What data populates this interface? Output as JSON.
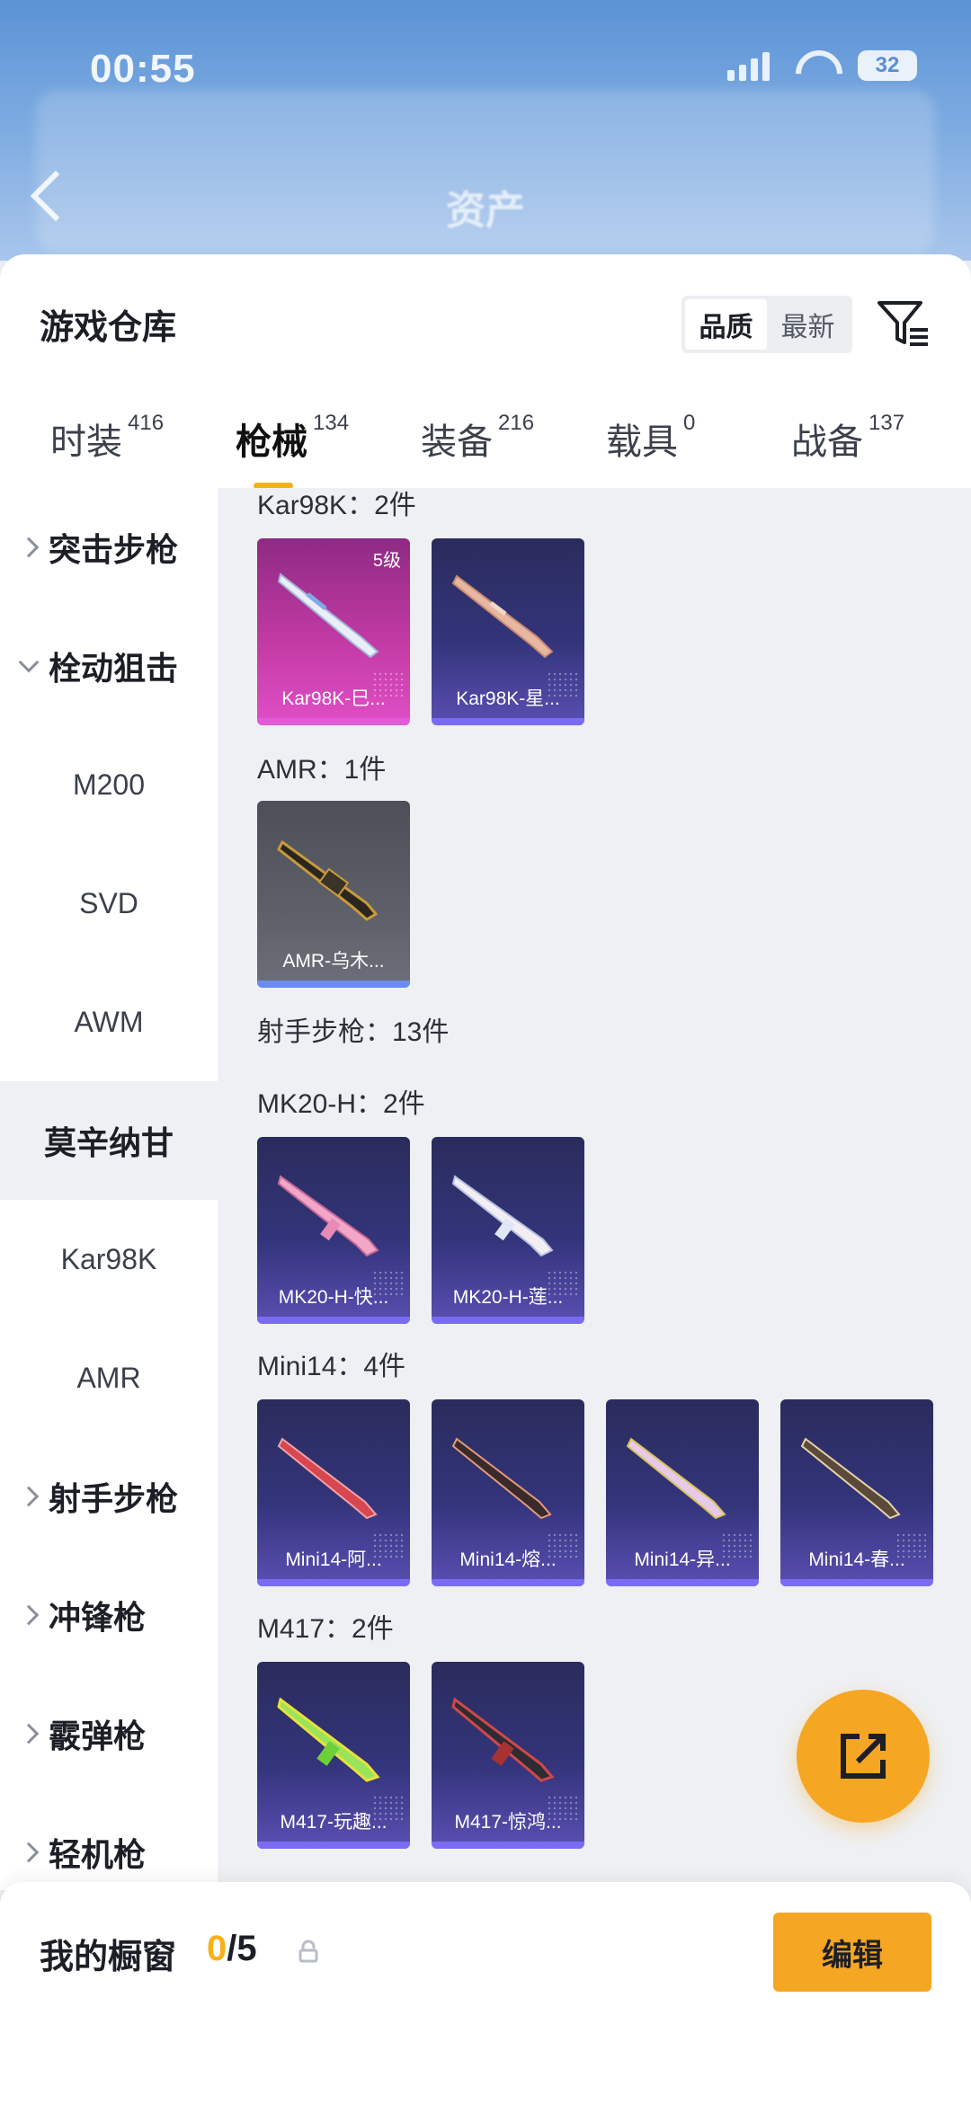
{
  "statusbar": {
    "time": "00:55",
    "battery": "32"
  },
  "nav": {
    "title": "资产"
  },
  "header": {
    "title": "游戏仓库",
    "sort": {
      "quality": "品质",
      "newest": "最新",
      "selected": "最新"
    }
  },
  "tabs": [
    {
      "label": "时装",
      "count": "416"
    },
    {
      "label": "枪械",
      "count": "134",
      "active": true
    },
    {
      "label": "装备",
      "count": "216"
    },
    {
      "label": "载具",
      "count": "0"
    },
    {
      "label": "战备",
      "count": "137"
    }
  ],
  "sidebar": [
    {
      "label": "突击步枪",
      "type": "category",
      "expanded": false
    },
    {
      "label": "栓动狙击",
      "type": "category",
      "expanded": true
    },
    {
      "label": "M200",
      "type": "sub"
    },
    {
      "label": "SVD",
      "type": "sub"
    },
    {
      "label": "AWM",
      "type": "sub"
    },
    {
      "label": "莫辛纳甘",
      "type": "sub",
      "selected": true
    },
    {
      "label": "Kar98K",
      "type": "sub"
    },
    {
      "label": "AMR",
      "type": "sub"
    },
    {
      "label": "射手步枪",
      "type": "category",
      "expanded": false
    },
    {
      "label": "冲锋枪",
      "type": "category",
      "expanded": false
    },
    {
      "label": "霰弹枪",
      "type": "category",
      "expanded": false
    },
    {
      "label": "轻机枪",
      "type": "category",
      "expanded": false
    }
  ],
  "groups": [
    {
      "title": "Kar98K：2件",
      "items": [
        {
          "name": "Kar98K-巳...",
          "level": "5级",
          "style": "gold"
        },
        {
          "name": "Kar98K-星...",
          "style": "purple"
        }
      ]
    },
    {
      "title": "AMR：1件",
      "items": [
        {
          "name": "AMR-乌木...",
          "style": "grey"
        }
      ]
    },
    {
      "title": "射手步枪：13件",
      "items": []
    },
    {
      "title": "MK20-H：2件",
      "items": [
        {
          "name": "MK20-H-快...",
          "style": "purple"
        },
        {
          "name": "MK20-H-莲...",
          "style": "purple"
        }
      ]
    },
    {
      "title": "Mini14：4件",
      "items": [
        {
          "name": "Mini14-阿...",
          "style": "purple"
        },
        {
          "name": "Mini14-熔...",
          "style": "purple"
        },
        {
          "name": "Mini14-异...",
          "style": "purple"
        },
        {
          "name": "Mini14-春...",
          "style": "purple"
        }
      ]
    },
    {
      "title": "M417：2件",
      "items": [
        {
          "name": "M417-玩趣...",
          "style": "purple"
        },
        {
          "name": "M417-惊鸿...",
          "style": "purple"
        }
      ]
    }
  ],
  "showcase": {
    "label": "我的橱窗",
    "current": "0",
    "total": "/5"
  },
  "edit_label": "编辑",
  "colors": {
    "accent": "#f5a623",
    "underline": "#f6b118"
  }
}
